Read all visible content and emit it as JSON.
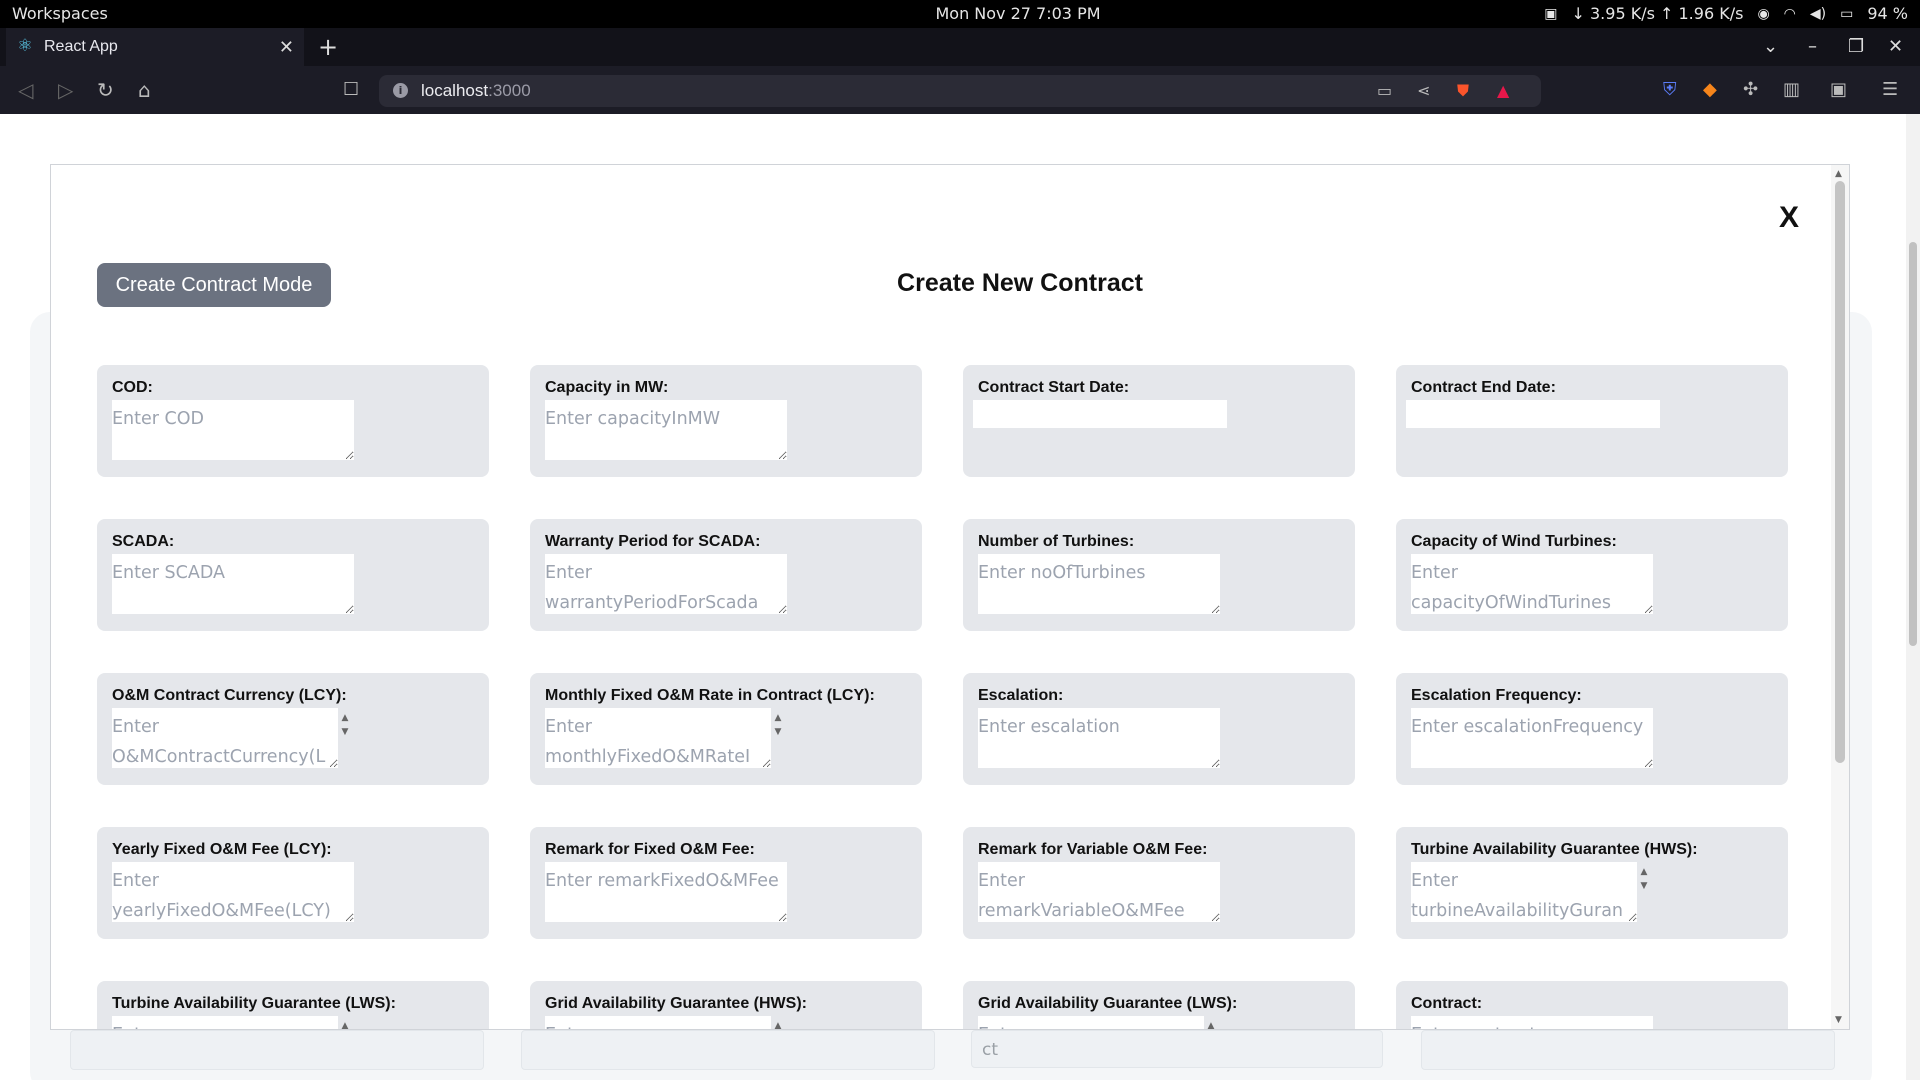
{
  "system": {
    "workspaces": "Workspaces",
    "clock": "Mon Nov 27   7:03 PM",
    "net_speed": "↓ 3.95 K/s ↑ 1.96 K/s",
    "battery": "94 %"
  },
  "browser": {
    "tab_title": "React App",
    "url_host": "localhost",
    "url_port": ":3000"
  },
  "modal": {
    "close_label": "X",
    "mode_button": "Create Contract Mode",
    "title": "Create New Contract",
    "fields": [
      {
        "label": "COD:",
        "placeholder": "Enter COD",
        "type": "textarea"
      },
      {
        "label": "Capacity in MW:",
        "placeholder": "Enter capacityInMW",
        "type": "textarea"
      },
      {
        "label": "Contract Start Date:",
        "placeholder": "",
        "type": "date"
      },
      {
        "label": "Contract End Date:",
        "placeholder": "",
        "type": "date"
      },
      {
        "label": "SCADA:",
        "placeholder": "Enter SCADA",
        "type": "textarea"
      },
      {
        "label": "Warranty Period for SCADA:",
        "placeholder": "Enter warrantyPeriodForScada",
        "type": "textarea"
      },
      {
        "label": "Number of Turbines:",
        "placeholder": "Enter noOfTurbines",
        "type": "textarea"
      },
      {
        "label": "Capacity of Wind Turbines:",
        "placeholder": "Enter capacityOfWindTurines",
        "type": "textarea"
      },
      {
        "label": "O&M Contract Currency (LCY):",
        "placeholder": "Enter O&MContractCurrency(L",
        "type": "textarea-scroll"
      },
      {
        "label": "Monthly Fixed O&M Rate in Contract (LCY):",
        "placeholder": "Enter monthlyFixedO&MRateI",
        "type": "textarea-scroll"
      },
      {
        "label": "Escalation:",
        "placeholder": "Enter escalation",
        "type": "textarea"
      },
      {
        "label": "Escalation Frequency:",
        "placeholder": "Enter escalationFrequency",
        "type": "textarea"
      },
      {
        "label": "Yearly Fixed O&M Fee (LCY):",
        "placeholder": "Enter yearlyFixedO&MFee(LCY)",
        "type": "textarea"
      },
      {
        "label": "Remark for Fixed O&M Fee:",
        "placeholder": "Enter remarkFixedO&MFee",
        "type": "textarea"
      },
      {
        "label": "Remark for Variable O&M Fee:",
        "placeholder": "Enter remarkVariableO&MFee",
        "type": "textarea"
      },
      {
        "label": "Turbine Availability Guarantee (HWS):",
        "placeholder": "Enter turbineAvailabilityGuran",
        "type": "textarea-scroll"
      },
      {
        "label": "Turbine Availability Guarantee (LWS):",
        "placeholder": "Enter",
        "type": "textarea-scroll"
      },
      {
        "label": "Grid Availability Guarantee (HWS):",
        "placeholder": "Enter",
        "type": "textarea-scroll"
      },
      {
        "label": "Grid Availability Guarantee (LWS):",
        "placeholder": "Enter",
        "type": "textarea-scroll"
      },
      {
        "label": "Contract:",
        "placeholder": "Enter contract",
        "type": "textarea"
      }
    ]
  },
  "background": {
    "partial_text": "ct"
  }
}
